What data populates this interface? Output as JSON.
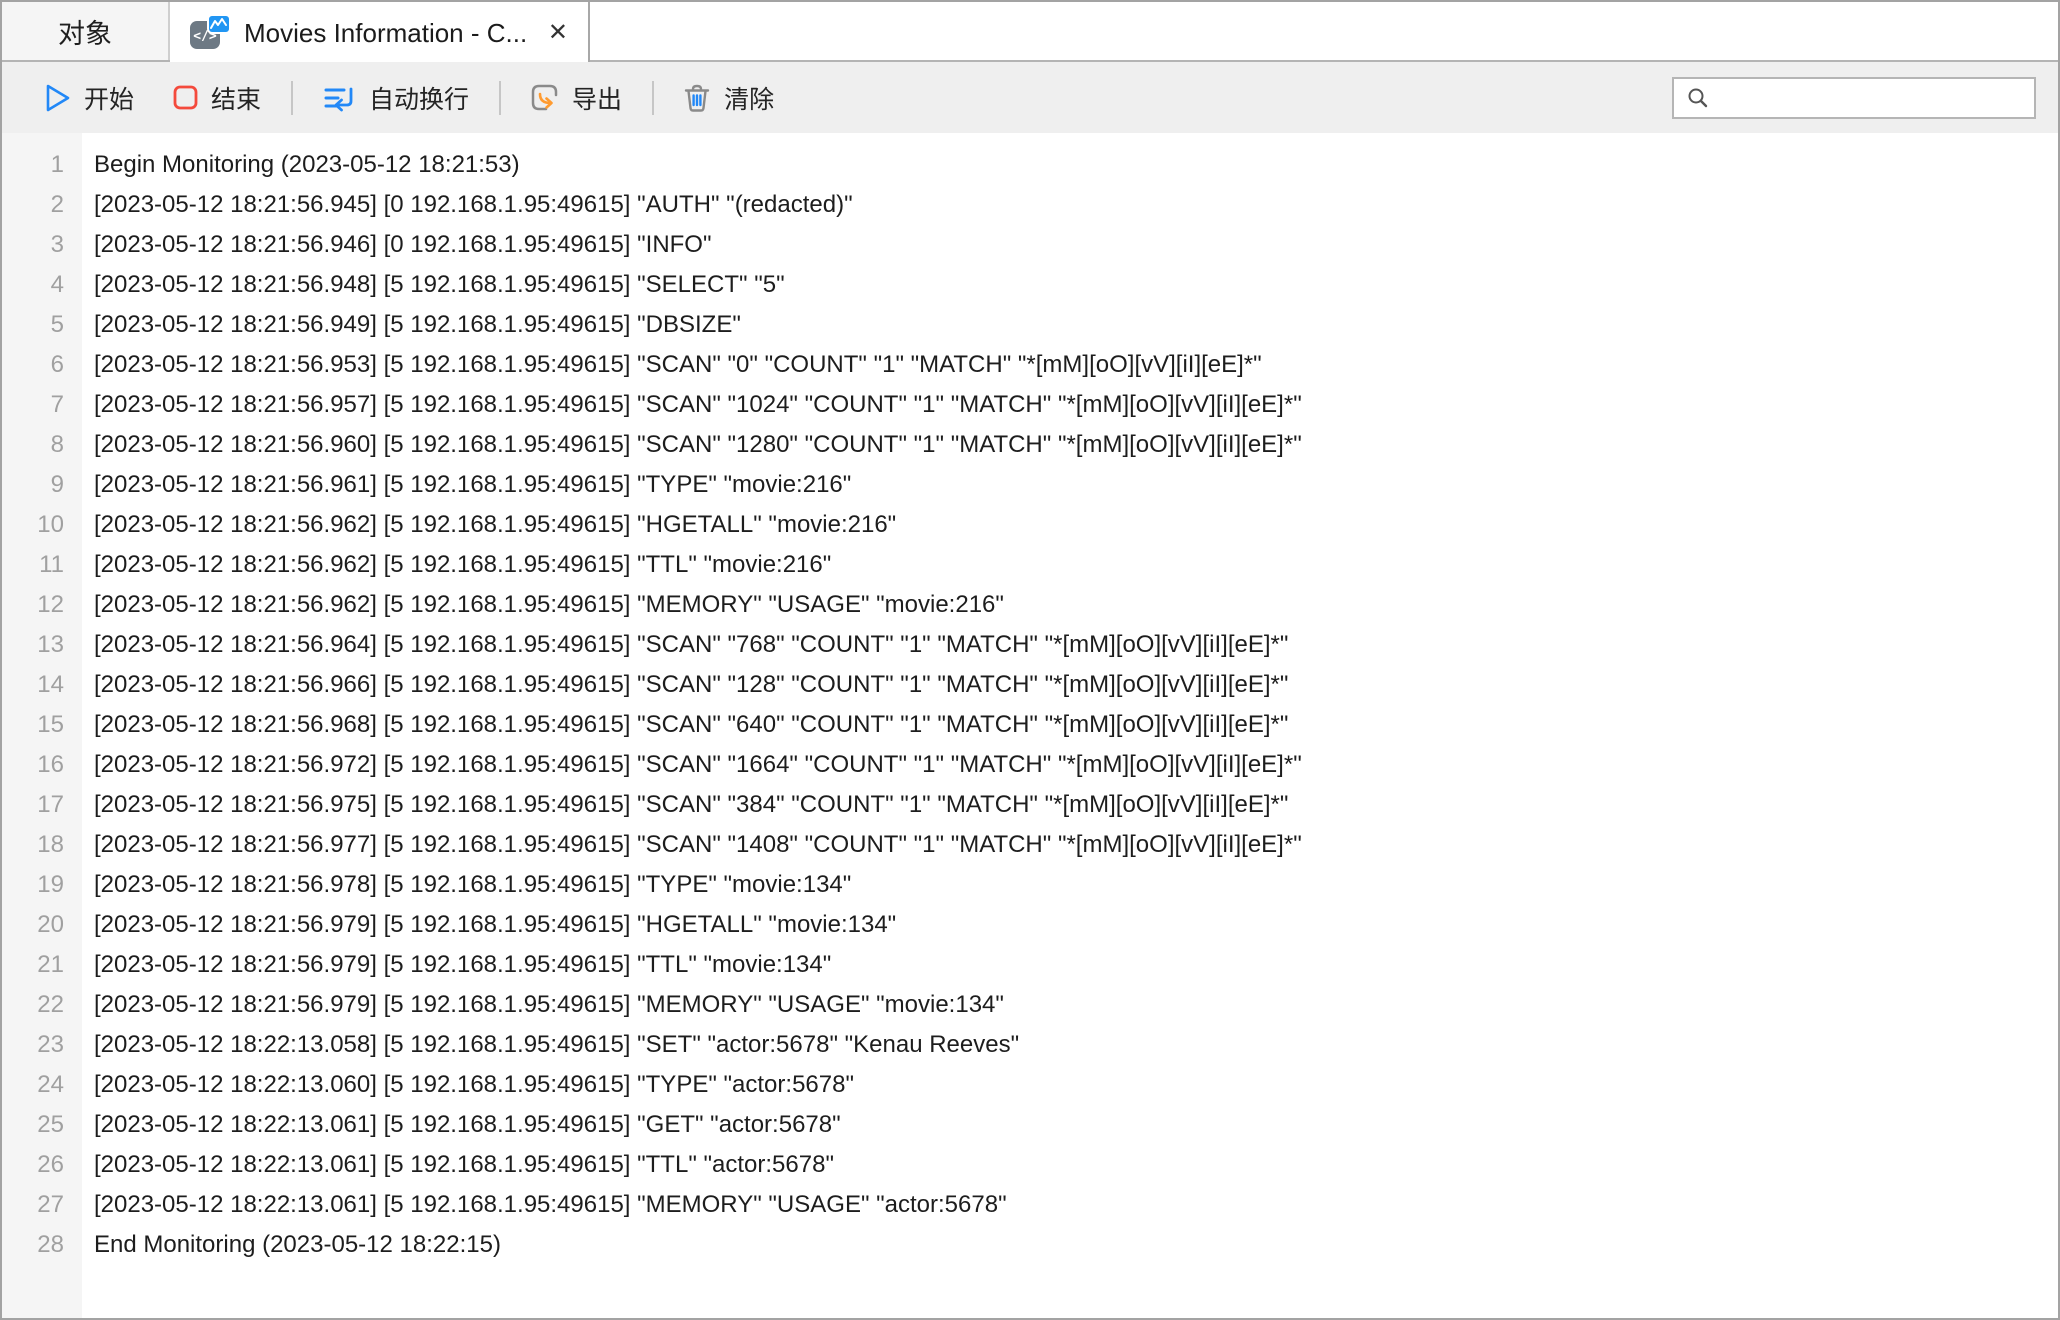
{
  "tabs": [
    {
      "id": "objects",
      "label": "对象",
      "active": false
    },
    {
      "id": "monitor",
      "label": "Movies Information - C...",
      "active": true,
      "icon": "monitor-log-icon",
      "close_glyph": "✕"
    }
  ],
  "toolbar": {
    "buttons": [
      {
        "id": "start",
        "label": "开始",
        "icon": "play-icon",
        "icon_color": "#2288f7"
      },
      {
        "id": "stop",
        "label": "结束",
        "icon": "stop-icon",
        "icon_color": "#f44a3c"
      },
      {
        "id": "wordwrap",
        "label": "自动换行",
        "icon": "word-wrap-icon",
        "icon_color": "#2288f7"
      },
      {
        "id": "export",
        "label": "导出",
        "icon": "export-icon",
        "icon_color": "#ff9b30"
      },
      {
        "id": "clear",
        "label": "清除",
        "icon": "trash-icon",
        "icon_color": "#8a8a8a"
      }
    ],
    "search": {
      "value": "",
      "placeholder": ""
    }
  },
  "log": {
    "lines": [
      "Begin Monitoring (2023-05-12 18:21:53)",
      "[2023-05-12 18:21:56.945] [0 192.168.1.95:49615] \"AUTH\" \"(redacted)\"",
      "[2023-05-12 18:21:56.946] [0 192.168.1.95:49615] \"INFO\"",
      "[2023-05-12 18:21:56.948] [5 192.168.1.95:49615] \"SELECT\" \"5\"",
      "[2023-05-12 18:21:56.949] [5 192.168.1.95:49615] \"DBSIZE\"",
      "[2023-05-12 18:21:56.953] [5 192.168.1.95:49615] \"SCAN\" \"0\" \"COUNT\" \"1\" \"MATCH\" \"*[mM][oO][vV][iI][eE]*\"",
      "[2023-05-12 18:21:56.957] [5 192.168.1.95:49615] \"SCAN\" \"1024\" \"COUNT\" \"1\" \"MATCH\" \"*[mM][oO][vV][iI][eE]*\"",
      "[2023-05-12 18:21:56.960] [5 192.168.1.95:49615] \"SCAN\" \"1280\" \"COUNT\" \"1\" \"MATCH\" \"*[mM][oO][vV][iI][eE]*\"",
      "[2023-05-12 18:21:56.961] [5 192.168.1.95:49615] \"TYPE\" \"movie:216\"",
      "[2023-05-12 18:21:56.962] [5 192.168.1.95:49615] \"HGETALL\" \"movie:216\"",
      "[2023-05-12 18:21:56.962] [5 192.168.1.95:49615] \"TTL\" \"movie:216\"",
      "[2023-05-12 18:21:56.962] [5 192.168.1.95:49615] \"MEMORY\" \"USAGE\" \"movie:216\"",
      "[2023-05-12 18:21:56.964] [5 192.168.1.95:49615] \"SCAN\" \"768\" \"COUNT\" \"1\" \"MATCH\" \"*[mM][oO][vV][iI][eE]*\"",
      "[2023-05-12 18:21:56.966] [5 192.168.1.95:49615] \"SCAN\" \"128\" \"COUNT\" \"1\" \"MATCH\" \"*[mM][oO][vV][iI][eE]*\"",
      "[2023-05-12 18:21:56.968] [5 192.168.1.95:49615] \"SCAN\" \"640\" \"COUNT\" \"1\" \"MATCH\" \"*[mM][oO][vV][iI][eE]*\"",
      "[2023-05-12 18:21:56.972] [5 192.168.1.95:49615] \"SCAN\" \"1664\" \"COUNT\" \"1\" \"MATCH\" \"*[mM][oO][vV][iI][eE]*\"",
      "[2023-05-12 18:21:56.975] [5 192.168.1.95:49615] \"SCAN\" \"384\" \"COUNT\" \"1\" \"MATCH\" \"*[mM][oO][vV][iI][eE]*\"",
      "[2023-05-12 18:21:56.977] [5 192.168.1.95:49615] \"SCAN\" \"1408\" \"COUNT\" \"1\" \"MATCH\" \"*[mM][oO][vV][iI][eE]*\"",
      "[2023-05-12 18:21:56.978] [5 192.168.1.95:49615] \"TYPE\" \"movie:134\"",
      "[2023-05-12 18:21:56.979] [5 192.168.1.95:49615] \"HGETALL\" \"movie:134\"",
      "[2023-05-12 18:21:56.979] [5 192.168.1.95:49615] \"TTL\" \"movie:134\"",
      "[2023-05-12 18:21:56.979] [5 192.168.1.95:49615] \"MEMORY\" \"USAGE\" \"movie:134\"",
      "[2023-05-12 18:22:13.058] [5 192.168.1.95:49615] \"SET\" \"actor:5678\" \"Kenau Reeves\"",
      "[2023-05-12 18:22:13.060] [5 192.168.1.95:49615] \"TYPE\" \"actor:5678\"",
      "[2023-05-12 18:22:13.061] [5 192.168.1.95:49615] \"GET\" \"actor:5678\"",
      "[2023-05-12 18:22:13.061] [5 192.168.1.95:49615] \"TTL\" \"actor:5678\"",
      "[2023-05-12 18:22:13.061] [5 192.168.1.95:49615] \"MEMORY\" \"USAGE\" \"actor:5678\"",
      "End Monitoring (2023-05-12 18:22:15)"
    ]
  },
  "colors": {
    "accent_blue": "#2288f7",
    "stop_red": "#f44a3c",
    "export_orange": "#ff9b30",
    "icon_gray": "#8a8a8a",
    "badge_blue": "#2196f3",
    "toolbar_bg": "#efefef",
    "gutter_bg": "#f5f5f5",
    "line_number": "#a0a0a0",
    "log_text": "#1d1d1d"
  }
}
